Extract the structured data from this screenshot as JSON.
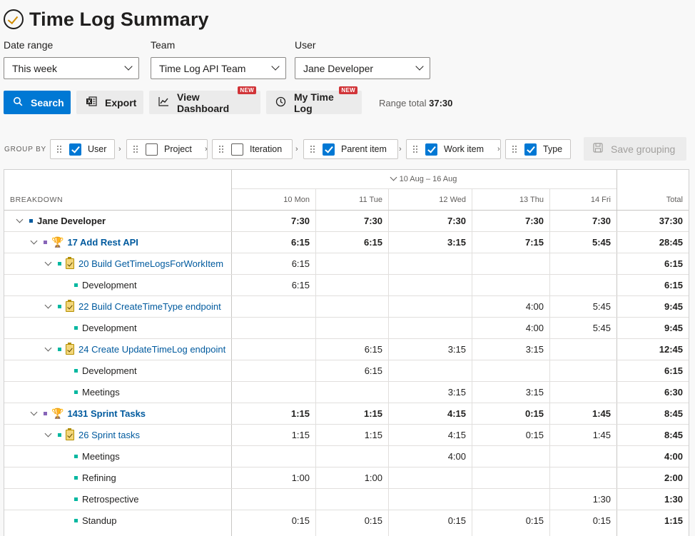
{
  "title": "Time Log Summary",
  "filters": {
    "date_range": {
      "label": "Date range",
      "value": "This week"
    },
    "team": {
      "label": "Team",
      "value": "Time Log API Team"
    },
    "user": {
      "label": "User",
      "value": "Jane Developer"
    }
  },
  "toolbar": {
    "search": "Search",
    "export": "Export",
    "view_dashboard": "View Dashboard",
    "my_time_log": "My Time Log",
    "new_badge": "NEW",
    "range_total_label": "Range total",
    "range_total_value": "37:30"
  },
  "group_by": {
    "label": "GROUP BY",
    "chips": [
      {
        "label": "User",
        "checked": true
      },
      {
        "label": "Project",
        "checked": false
      },
      {
        "label": "Iteration",
        "checked": false
      },
      {
        "label": "Parent item",
        "checked": true
      },
      {
        "label": "Work item",
        "checked": true
      },
      {
        "label": "Type",
        "checked": true
      }
    ],
    "separator": "›",
    "save": "Save grouping"
  },
  "grid": {
    "range_header": "10 Aug – 16 Aug",
    "breakdown_header": "BREAKDOWN",
    "columns": [
      "10 Mon",
      "11 Tue",
      "12 Wed",
      "13 Thu",
      "14 Fri"
    ],
    "total_header": "Total",
    "rows": [
      {
        "label": "Jane Developer",
        "values": [
          "7:30",
          "7:30",
          "7:30",
          "7:30",
          "7:30"
        ],
        "total": "37:30"
      },
      {
        "label": "17 Add Rest API",
        "values": [
          "6:15",
          "6:15",
          "3:15",
          "7:15",
          "5:45"
        ],
        "total": "28:45"
      },
      {
        "label": "20 Build GetTimeLogsForWorkItem",
        "values": [
          "6:15",
          "",
          "",
          "",
          ""
        ],
        "total": "6:15"
      },
      {
        "label": "Development",
        "values": [
          "6:15",
          "",
          "",
          "",
          ""
        ],
        "total": "6:15"
      },
      {
        "label": "22 Build CreateTimeType endpoint",
        "values": [
          "",
          "",
          "",
          "4:00",
          "5:45"
        ],
        "total": "9:45"
      },
      {
        "label": "Development",
        "values": [
          "",
          "",
          "",
          "4:00",
          "5:45"
        ],
        "total": "9:45"
      },
      {
        "label": "24 Create UpdateTimeLog endpoint",
        "values": [
          "",
          "6:15",
          "3:15",
          "3:15",
          ""
        ],
        "total": "12:45"
      },
      {
        "label": "Development",
        "values": [
          "",
          "6:15",
          "",
          "",
          ""
        ],
        "total": "6:15"
      },
      {
        "label": "Meetings",
        "values": [
          "",
          "",
          "3:15",
          "3:15",
          ""
        ],
        "total": "6:30"
      },
      {
        "label": "1431 Sprint Tasks",
        "values": [
          "1:15",
          "1:15",
          "4:15",
          "0:15",
          "1:45"
        ],
        "total": "8:45"
      },
      {
        "label": "26 Sprint tasks",
        "values": [
          "1:15",
          "1:15",
          "4:15",
          "0:15",
          "1:45"
        ],
        "total": "8:45"
      },
      {
        "label": "Meetings",
        "values": [
          "",
          "",
          "4:00",
          "",
          ""
        ],
        "total": "4:00"
      },
      {
        "label": "Refining",
        "values": [
          "1:00",
          "1:00",
          "",
          "",
          ""
        ],
        "total": "2:00"
      },
      {
        "label": "Retrospective",
        "values": [
          "",
          "",
          "",
          "",
          "1:30"
        ],
        "total": "1:30"
      },
      {
        "label": "Standup",
        "values": [
          "0:15",
          "0:15",
          "0:15",
          "0:15",
          "0:15"
        ],
        "total": "1:15"
      }
    ]
  }
}
